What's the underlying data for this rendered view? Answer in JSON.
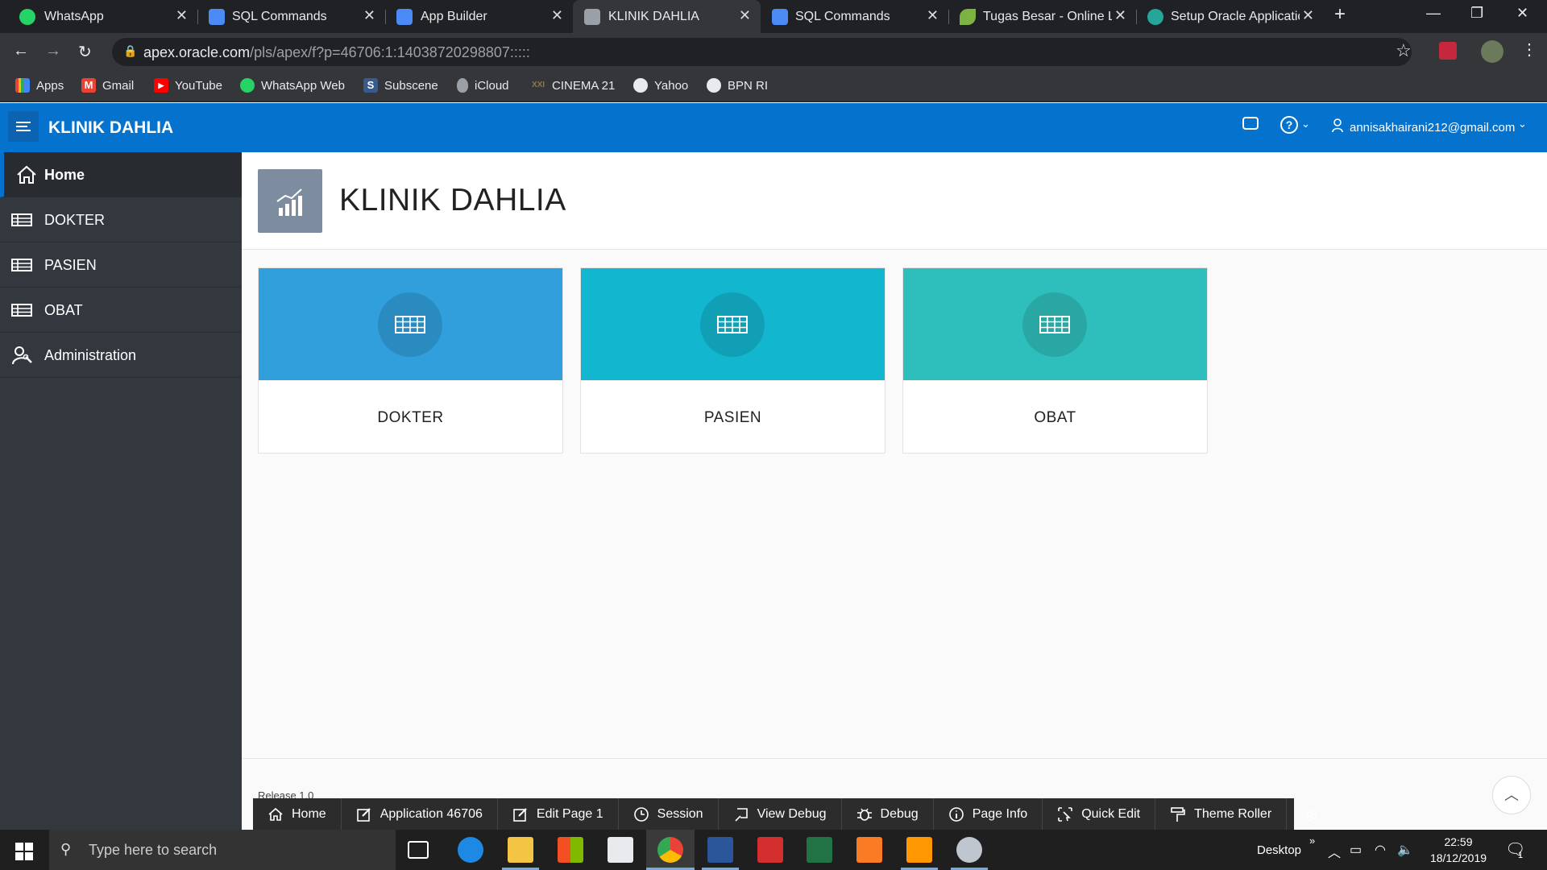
{
  "browser": {
    "tabs": [
      {
        "title": "WhatsApp",
        "icon": "whatsapp-icon",
        "color": "#25d366"
      },
      {
        "title": "SQL Commands",
        "icon": "apex-icon",
        "color": "#4c8bf5"
      },
      {
        "title": "App Builder",
        "icon": "apex-icon",
        "color": "#4c8bf5"
      },
      {
        "title": "KLINIK DAHLIA",
        "icon": "apex-icon",
        "color": "#9aa0a6"
      },
      {
        "title": "SQL Commands",
        "icon": "apex-icon",
        "color": "#4c8bf5"
      },
      {
        "title": "Tugas Besar - Online L",
        "icon": "leaf-icon",
        "color": "#7cb342"
      },
      {
        "title": "Setup Oracle Applicatio",
        "icon": "globe-icon",
        "color": "#26a69a"
      }
    ],
    "url_host": "apex.oracle.com",
    "url_path": "/pls/apex/f?p=46706:1:14038720298807:::::",
    "bookmarks": [
      {
        "label": "Apps",
        "icon": "apps-grid-icon"
      },
      {
        "label": "Gmail",
        "icon": "gmail-icon"
      },
      {
        "label": "YouTube",
        "icon": "youtube-icon"
      },
      {
        "label": "WhatsApp Web",
        "icon": "whatsapp-icon"
      },
      {
        "label": "Subscene",
        "icon": "subscene-icon"
      },
      {
        "label": "iCloud",
        "icon": "apple-icon"
      },
      {
        "label": "CINEMA 21",
        "icon": "cinema-icon"
      },
      {
        "label": "Yahoo",
        "icon": "globe-icon"
      },
      {
        "label": "BPN RI",
        "icon": "globe-icon"
      }
    ]
  },
  "header": {
    "app_title": "KLINIK DAHLIA",
    "user_email": "annisakhairani212@gmail.com",
    "accent": "#0572ce"
  },
  "sidebar": {
    "items": [
      {
        "label": "Home",
        "icon": "home-icon"
      },
      {
        "label": "DOKTER",
        "icon": "table-icon"
      },
      {
        "label": "PASIEN",
        "icon": "table-icon"
      },
      {
        "label": "OBAT",
        "icon": "table-icon"
      },
      {
        "label": "Administration",
        "icon": "user-wrench-icon"
      }
    ]
  },
  "main": {
    "page_title": "KLINIK DAHLIA",
    "cards": [
      {
        "label": "DOKTER",
        "color": "#309fdb",
        "icon": "table-icon"
      },
      {
        "label": "PASIEN",
        "color": "#13b6cf",
        "icon": "table-icon"
      },
      {
        "label": "OBAT",
        "color": "#2ebfbc",
        "icon": "table-icon"
      }
    ],
    "release": "Release 1.0"
  },
  "devbar": {
    "items": [
      {
        "label": "Home",
        "icon": "home-icon"
      },
      {
        "label": "Application 46706",
        "icon": "edit-icon"
      },
      {
        "label": "Edit Page 1",
        "icon": "edit-icon"
      },
      {
        "label": "Session",
        "icon": "clock-icon"
      },
      {
        "label": "View Debug",
        "icon": "debug-view-icon"
      },
      {
        "label": "Debug",
        "icon": "bug-icon"
      },
      {
        "label": "Page Info",
        "icon": "info-icon"
      },
      {
        "label": "Quick Edit",
        "icon": "cursor-icon"
      },
      {
        "label": "Theme Roller",
        "icon": "paint-roller-icon"
      }
    ]
  },
  "taskbar": {
    "search_placeholder": "Type here to search",
    "desktop_label": "Desktop",
    "time": "22:59",
    "date": "18/12/2019",
    "notification_count": "1"
  }
}
